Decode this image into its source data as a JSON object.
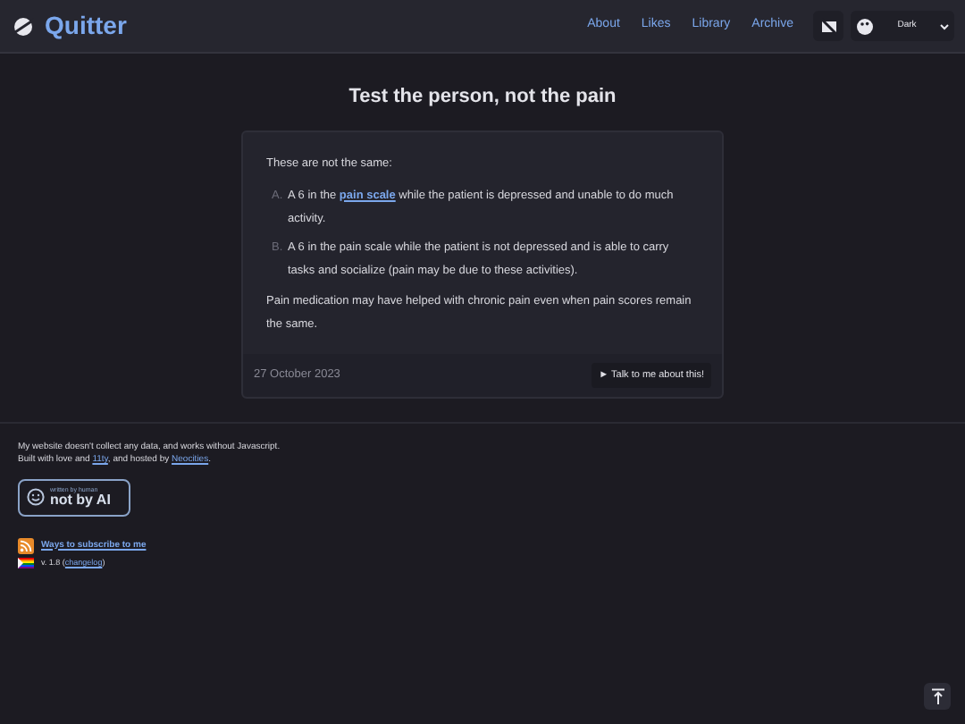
{
  "header": {
    "logo": "Quitter",
    "nav": [
      "About",
      "Likes",
      "Library",
      "Archive"
    ],
    "theme_select": {
      "value": "Dark"
    }
  },
  "post": {
    "title": "Test the person, not the pain",
    "intro": "These are not the same:",
    "items": [
      {
        "marker": "A.",
        "before": "A 6 in the ",
        "link": "pain scale",
        "after": " while the patient is depressed and unable to do much activity."
      },
      {
        "marker": "B.",
        "before": "A 6 in the pain scale while the patient is not depressed and is able to carry tasks and socialize (pain may be due to these activities)."
      }
    ],
    "closing": "Pain medication may have helped with chronic pain even when pain scores remain the same.",
    "date": "27 October 2023",
    "talk_button": "► Talk to me about this!"
  },
  "footer": {
    "line1": "My website doesn't collect any data, and works without Javascript.",
    "line2": [
      {
        "kind": "text",
        "text": "Built with love and "
      },
      {
        "kind": "link",
        "text": "11ty"
      },
      {
        "kind": "text",
        "text": ", and hosted by "
      },
      {
        "kind": "link",
        "text": "Neocities"
      },
      {
        "kind": "text",
        "text": "."
      }
    ],
    "badge_small": "written by human",
    "badge_big": "not by AI",
    "subscribe": "Ways to subscribe to me",
    "version": "v. 1.8 (",
    "changelog": "changelog",
    "version_end": ")"
  }
}
